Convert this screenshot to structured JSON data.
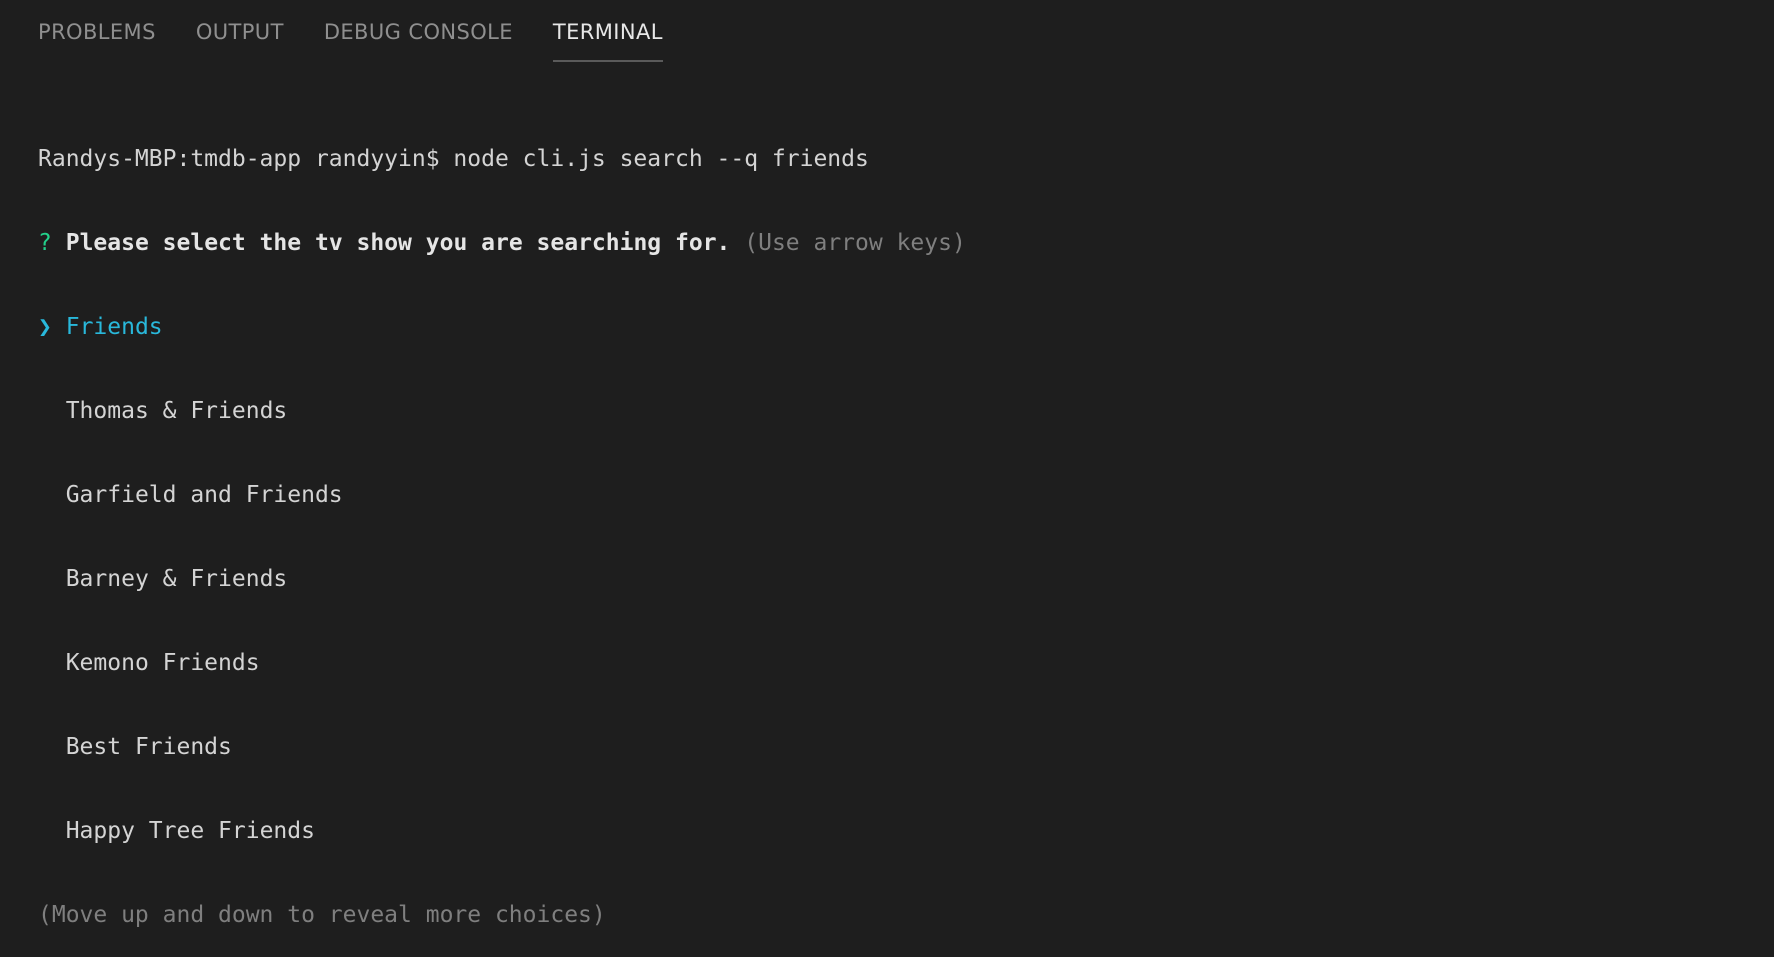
{
  "panel": {
    "tabs": [
      {
        "label": "PROBLEMS",
        "active": false
      },
      {
        "label": "OUTPUT",
        "active": false
      },
      {
        "label": "DEBUG CONSOLE",
        "active": false
      },
      {
        "label": "TERMINAL",
        "active": true
      }
    ]
  },
  "terminal": {
    "prompt": "Randys-MBP:tmdb-app randyyin$ ",
    "command": "node cli.js search --q friends",
    "question_mark": "?",
    "question": "Please select the tv show you are searching for.",
    "hint": "(Use arrow keys)",
    "pointer": "❯",
    "choices": [
      "Friends",
      "Thomas & Friends",
      "Garfield and Friends",
      "Barney & Friends",
      "Kemono Friends",
      "Best Friends",
      "Happy Tree Friends"
    ],
    "footer": "(Move up and down to reveal more choices)"
  },
  "colors": {
    "background": "#1e1e1e",
    "question_mark": "#23d18b",
    "selected": "#29b8db",
    "dim": "#7f7f7f"
  }
}
